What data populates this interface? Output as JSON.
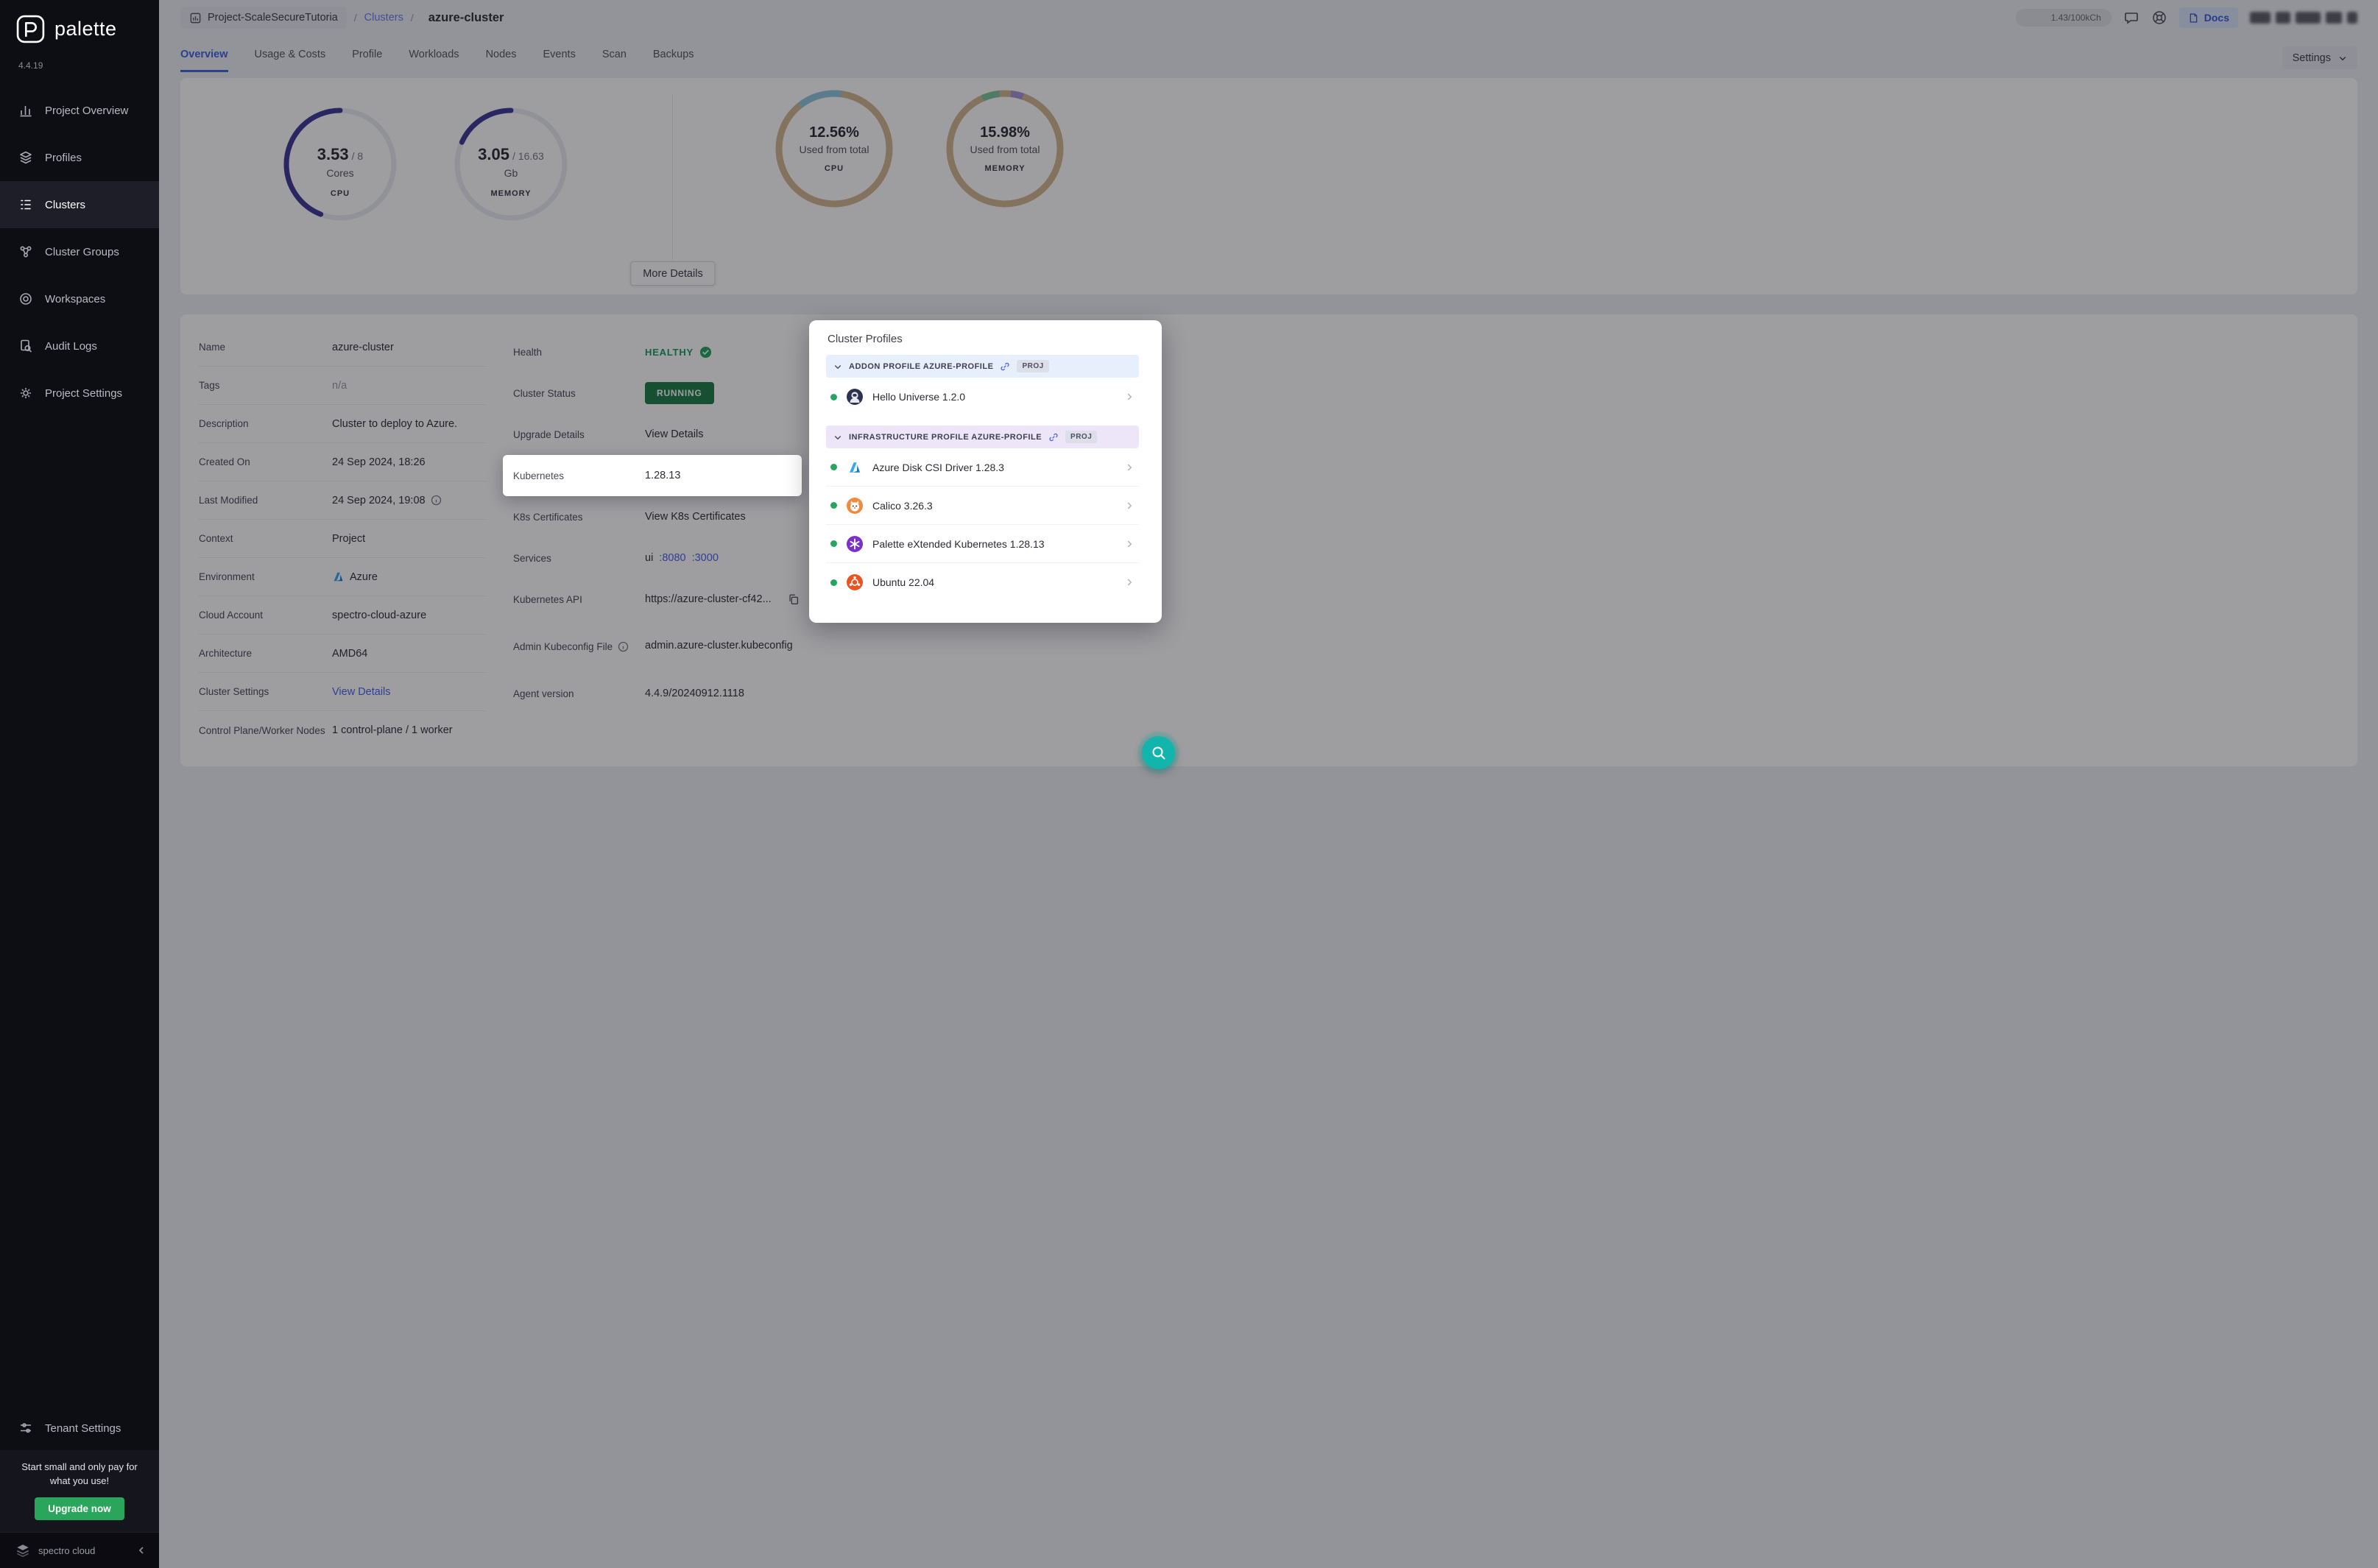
{
  "sidebar": {
    "brand": "palette",
    "version": "4.4.19",
    "nav": [
      {
        "label": "Project Overview"
      },
      {
        "label": "Profiles"
      },
      {
        "label": "Clusters"
      },
      {
        "label": "Cluster Groups"
      },
      {
        "label": "Workspaces"
      },
      {
        "label": "Audit Logs"
      },
      {
        "label": "Project Settings"
      }
    ],
    "tenant_settings": "Tenant Settings",
    "promo_text": "Start small and only pay for what you use!",
    "upgrade_button": "Upgrade now",
    "footer_brand": "spectro cloud"
  },
  "header": {
    "project": "Project-ScaleSecureTutoria",
    "crumb_sep": "/",
    "crumb_section": "Clusters",
    "cluster": "azure-cluster",
    "usage": "1.43/100kCh",
    "docs": "Docs"
  },
  "tabs": {
    "labels": [
      "Overview",
      "Usage & Costs",
      "Profile",
      "Workloads",
      "Nodes",
      "Events",
      "Scan",
      "Backups"
    ],
    "settings": "Settings"
  },
  "stats": {
    "cpu_gauge": {
      "value": "3.53",
      "total": "/ 8",
      "unit": "Cores",
      "label": "CPU",
      "fraction": 0.441
    },
    "memory_gauge": {
      "value": "3.05",
      "total": "/ 16.63",
      "unit": "Gb",
      "label": "MEMORY",
      "fraction": 0.183
    },
    "cpu_donut": {
      "percent": "12.56%",
      "caption": "Used from total",
      "label": "CPU",
      "fraction": 0.1256
    },
    "memory_donut": {
      "percent": "15.98%",
      "caption": "Used from total",
      "label": "MEMORY",
      "fraction": 0.1598
    },
    "more_details": "More Details"
  },
  "details": {
    "left": [
      {
        "label": "Name",
        "value": "azure-cluster"
      },
      {
        "label": "Tags",
        "value": "n/a"
      },
      {
        "label": "Description",
        "value": "Cluster to deploy to Azure."
      },
      {
        "label": "Created On",
        "value": "24 Sep 2024, 18:26"
      },
      {
        "label": "Last Modified",
        "value": "24 Sep 2024, 19:08"
      },
      {
        "label": "Context",
        "value": "Project"
      },
      {
        "label": "Environment",
        "value": "Azure"
      },
      {
        "label": "Cloud Account",
        "value": "spectro-cloud-azure"
      },
      {
        "label": "Architecture",
        "value": "AMD64"
      },
      {
        "label": "Cluster Settings",
        "value": "View Details"
      },
      {
        "label": "Control Plane/Worker Nodes",
        "value": "1 control-plane / 1 worker"
      }
    ],
    "right": {
      "health_label": "Health",
      "health_value": "HEALTHY",
      "status_label": "Cluster Status",
      "status_value": "RUNNING",
      "upgrade_label": "Upgrade Details",
      "upgrade_value": "View Details",
      "kubernetes_label": "Kubernetes",
      "kubernetes_value": "1.28.13",
      "certs_label": "K8s Certificates",
      "certs_value": "View K8s Certificates",
      "services_label": "Services",
      "services_name": "ui",
      "services_port1": ":8080",
      "services_port2": ":3000",
      "api_label": "Kubernetes API",
      "api_value": "https://azure-cluster-cf42...",
      "kubeconfig_label": "Admin Kubeconfig File",
      "kubeconfig_value": "admin.azure-cluster.kubeconfig",
      "agent_label": "Agent version",
      "agent_value": "4.4.9/20240912.1118"
    }
  },
  "cluster_profiles": {
    "title": "Cluster Profiles",
    "sections": [
      {
        "header": "ADDON PROFILE AZURE-PROFILE",
        "badge": "PROJ",
        "items": [
          {
            "name": "Hello Universe 1.2.0"
          }
        ]
      },
      {
        "header": "INFRASTRUCTURE PROFILE AZURE-PROFILE",
        "badge": "PROJ",
        "items": [
          {
            "name": "Azure Disk CSI Driver 1.28.3"
          },
          {
            "name": "Calico 3.26.3"
          },
          {
            "name": "Palette eXtended Kubernetes 1.28.13"
          },
          {
            "name": "Ubuntu 22.04"
          }
        ]
      }
    ]
  }
}
